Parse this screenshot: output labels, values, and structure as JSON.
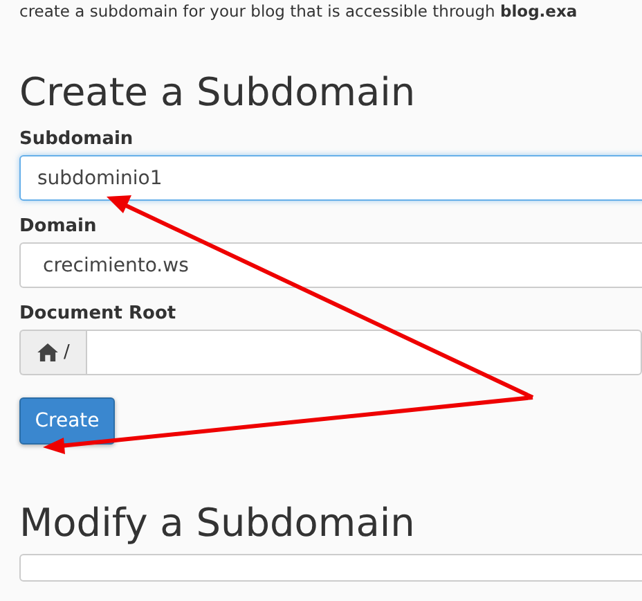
{
  "intro": "create a subdomain for your blog that is accessible through **blog.exa**",
  "create_section": {
    "title": "Create a Subdomain",
    "fields": [
      {
        "kind": "text",
        "label": "Subdomain",
        "value": "subdominio1",
        "focused": true
      },
      {
        "kind": "select",
        "label": "Domain",
        "value": "crecimiento.ws",
        "focused": false
      },
      {
        "kind": "path",
        "label": "Document Root",
        "prefix": "/",
        "focused": false
      }
    ],
    "button": "Create"
  },
  "modify_section": {
    "title": "Modify a Subdomain"
  }
}
